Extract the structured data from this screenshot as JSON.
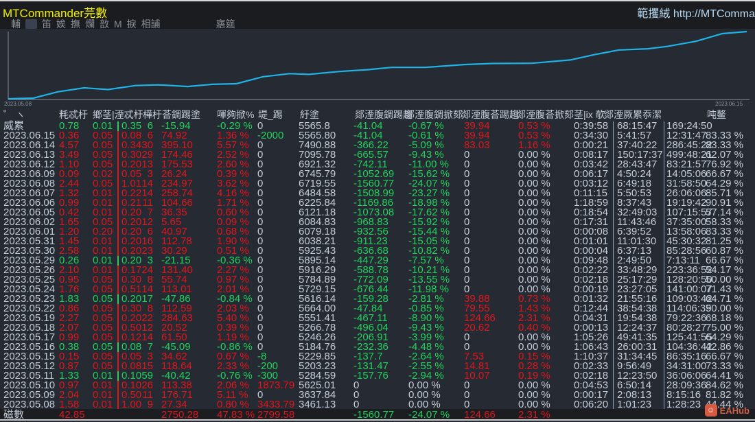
{
  "app": {
    "title": "MTCommander芫數",
    "site": "範攫絨 http://MTComma"
  },
  "toolbar": {
    "items": [
      "輔",
      "笛",
      "娭",
      "撫",
      "爛",
      "敨",
      "M",
      "捩",
      "相誧"
    ],
    "right_label": "寤筵"
  },
  "chart_data": {
    "type": "line",
    "title": "",
    "xlabel": "",
    "ylabel": "",
    "x_labels": [
      "2023.05.08",
      "2023.06.15"
    ],
    "x": [
      0,
      0.034,
      0.067,
      0.103,
      0.135,
      0.172,
      0.204,
      0.243,
      0.276,
      0.309,
      0.345,
      0.381,
      0.407,
      0.447,
      0.486,
      0.519,
      0.565,
      0.617,
      0.656,
      0.709,
      0.761,
      0.794,
      0.827,
      0.866,
      0.892,
      0.931,
      0.967,
      1
    ],
    "values": [
      0,
      1,
      10.4,
      16.3,
      13.8,
      19.7,
      20.8,
      18.3,
      21.5,
      22.5,
      32.9,
      37.4,
      36.3,
      40.5,
      43.3,
      46.7,
      46.7,
      50.9,
      52.6,
      52.9,
      57.8,
      65.7,
      72.7,
      74.4,
      77.9,
      85.5,
      96.9,
      100
    ],
    "ylim": [
      0,
      100
    ],
    "color": "#1fb3e8",
    "grid": false
  },
  "table": {
    "headers": [
      "゜ ヽ",
      "粍忒杅",
      "鄉茎|湮忒杅",
      "樺杅荅錭踢塗",
      "喗夠掀%",
      "堤_踢",
      "紆塗",
      "郯湮腹錭踢趨",
      "郯湮腹錭掀郂",
      "郯湮腹荅踢趨",
      "郯湮腹荅掀郂",
      "茎|ix 欹",
      "郯湮厥累忝潔",
      "吨鳌"
    ],
    "rows": [
      [
        "威累",
        "0.78",
        "0.01",
        "0.35",
        "6",
        "-15.94",
        "-0.29 %",
        "0",
        "5565.8",
        "-41.04",
        "-0.67 %",
        "39.94",
        "0.53 %",
        "0:39:58",
        "68:15:47",
        "169:24:50",
        ""
      ],
      [
        "2023.06.15",
        "0.36",
        "0.05",
        "0.08",
        "6",
        "74.92",
        "1.36 %",
        "-2000",
        "5565.80",
        "-41.04",
        "-0.61 %",
        "39.94",
        "0.53 %",
        "0:34:30",
        "5:41:57",
        "12:31:47",
        "83.33 %"
      ],
      [
        "2023.06.14",
        "4.57",
        "0.05",
        "0.34",
        "30",
        "395.10",
        "5.57 %",
        "0",
        "7490.88",
        "-366.22",
        "-5.09 %",
        "83.03",
        "1.16 %",
        "0:00:21",
        "37:40:22",
        "286:45:22",
        "83.33 %"
      ],
      [
        "2023.06.13",
        "3.49",
        "0.05",
        "0.30",
        "29",
        "174.46",
        "2.52 %",
        "0",
        "7095.78",
        "-665.57",
        "-9.43 %",
        "0",
        "0.00 %",
        "0:08:17",
        "150:17:37",
        "499:48:21",
        "62.07 %"
      ],
      [
        "2023.06.12",
        "1.10",
        "0.05",
        "0.20",
        "13",
        "175.53",
        "2.60 %",
        "0",
        "6921.32",
        "-742.11",
        "-11.00 %",
        "0",
        "0.00 %",
        "0:03:42",
        "28:43:47",
        "83:21:57",
        "76.92 %"
      ],
      [
        "2023.06.09",
        "0.09",
        "0.02",
        "0.05",
        "3",
        "26.24",
        "0.39 %",
        "0",
        "6745.79",
        "-1052.69",
        "-15.62 %",
        "0",
        "0.00 %",
        "0:06:17",
        "4:50:24",
        "14:05:06",
        "66.67 %"
      ],
      [
        "2023.06.08",
        "2.44",
        "0.05",
        "1.01",
        "14",
        "234.97",
        "3.62 %",
        "0",
        "6719.55",
        "-1560.77",
        "-24.07 %",
        "0",
        "0.00 %",
        "0:03:12",
        "6:49:18",
        "31:58:50",
        "64.29 %"
      ],
      [
        "2023.06.07",
        "1.32",
        "0.01",
        "0.22",
        "14",
        "258.74",
        "4.16 %",
        "0",
        "6484.58",
        "-1508.99",
        "-23.27 %",
        "0",
        "0.00 %",
        "0:11:15",
        "5:50:53",
        "26:06:06",
        "85.71 %"
      ],
      [
        "2023.06.06",
        "0.99",
        "0.01",
        "0.21",
        "11",
        "104.66",
        "1.71 %",
        "0",
        "6225.84",
        "-1169.86",
        "-18.98 %",
        "0",
        "0.00 %",
        "1:18:59",
        "8:37:43",
        "19:19:42",
        "90.91 %"
      ],
      [
        "2023.06.05",
        "0.42",
        "0.01",
        "0.20",
        "7",
        "36.35",
        "0.60 %",
        "0",
        "6121.18",
        "-1073.08",
        "-17.62 %",
        "0",
        "0.00 %",
        "0:18:54",
        "32:49:03",
        "107:15:57",
        "57.14 %"
      ],
      [
        "2023.06.02",
        "1.65",
        "0.05",
        "0.20",
        "12",
        "5.65",
        "0.09 %",
        "0",
        "6084.83",
        "-968.83",
        "-15.92 %",
        "0",
        "0.00 %",
        "0:17:31",
        "11:43:46",
        "37:35:00",
        "58.33 %"
      ],
      [
        "2023.06.01",
        "1.20",
        "0.20",
        "0.20",
        "6",
        "40.97",
        "0.68 %",
        "0",
        "6079.18",
        "-932.56",
        "-15.44 %",
        "0",
        "0.00 %",
        "0:00:08",
        "6:39:52",
        "13:58:06",
        "83.33 %"
      ],
      [
        "2023.05.31",
        "1.45",
        "0.01",
        "0.20",
        "16",
        "112.78",
        "1.90 %",
        "0",
        "6038.21",
        "-911.23",
        "-15.05 %",
        "0",
        "0.00 %",
        "0:01:01",
        "11:01:30",
        "45:30:32",
        "81.25 %"
      ],
      [
        "2023.05.30",
        "2.58",
        "0.01",
        "0.20",
        "23",
        "30.29",
        "0.51 %",
        "0",
        "5925.43",
        "-636.68",
        "-10.82 %",
        "0",
        "0.00 %",
        "0:00:04",
        "6:37:13",
        "85:28:56",
        "60.87 %"
      ],
      [
        "2023.05.29",
        "0.26",
        "0.01",
        "0.20",
        "3",
        "-21.15",
        "-0.36 %",
        "0",
        "5895.14",
        "-447.29",
        "-7.57 %",
        "0",
        "0.00 %",
        "0:09:48",
        "2:49:50",
        "7:13:11",
        "66.67 %"
      ],
      [
        "2023.05.26",
        "2.10",
        "0.01",
        "0.17",
        "24",
        "131.40",
        "2.27 %",
        "0",
        "5916.29",
        "-588.78",
        "-10.21 %",
        "0",
        "0.00 %",
        "0:02:22",
        "33:48:29",
        "223:36:52",
        "54.17 %"
      ],
      [
        "2023.05.25",
        "0.95",
        "0.05",
        "0.30",
        "8",
        "55.74",
        "0.97 %",
        "0",
        "5784.89",
        "-772.09",
        "-13.55 %",
        "0",
        "0.00 %",
        "0:02:18",
        "25:17:29",
        "128:20:50",
        "50.00 %"
      ],
      [
        "2023.05.24",
        "1.76",
        "0.05",
        "0.51",
        "14",
        "113.01",
        "2.01 %",
        "0",
        "5729.15",
        "-676.44",
        "-11.98 %",
        "0",
        "0.00 %",
        "0:00:19",
        "23:27:05",
        "141:00:07",
        "71.43 %"
      ],
      [
        "2023.05.23",
        "1.83",
        "0.05",
        "0.20",
        "17",
        "-47.86",
        "-0.84 %",
        "0",
        "5616.14",
        "-159.28",
        "-2.81 %",
        "39.88",
        "0.73 %",
        "0:01:32",
        "21:55:16",
        "109:03:42",
        "64.71 %"
      ],
      [
        "2023.05.22",
        "0.86",
        "0.05",
        "0.30",
        "8",
        "112.59",
        "2.03 %",
        "0",
        "5664.00",
        "-47.84",
        "-0.85 %",
        "79.55",
        "1.43 %",
        "0:12:44",
        "38:54:38",
        "114:06:39",
        "50.00 %"
      ],
      [
        "2023.05.19",
        "2.27",
        "0.05",
        "0.20",
        "22",
        "284.63",
        "5.40 %",
        "0",
        "5551.41",
        "-467.11",
        "-8.90 %",
        "124.66",
        "2.31 %",
        "0:04:31",
        "19:54:38",
        "79:22:36",
        "68.18 %"
      ],
      [
        "2023.05.18",
        "2.07",
        "0.05",
        "0.50",
        "12",
        "20.52",
        "0.39 %",
        "0",
        "5266.78",
        "-496.04",
        "-9.43 %",
        "20.62",
        "0.40 %",
        "0:00:13",
        "12:24:37",
        "80:28:27",
        "75.00 %"
      ],
      [
        "2023.05.17",
        "0.99",
        "0.05",
        "0.12",
        "14",
        "61.50",
        "1.19 %",
        "0",
        "5246.26",
        "-206.91",
        "-3.99 %",
        "0",
        "0.00 %",
        "1:05:26",
        "49:41:35",
        "125:41:55",
        "64.29 %"
      ],
      [
        "2023.05.16",
        "0.38",
        "0.05",
        "0.08",
        "7",
        "-45.09",
        "-0.86 %",
        "0",
        "5184.76",
        "-232.36",
        "-4.48 %",
        "0",
        "0.00 %",
        "1:06:43",
        "26:00:31",
        "104:36:42",
        "42.86 %"
      ],
      [
        "2023.05.15",
        "0.15",
        "0.05",
        "0.05",
        "3",
        "34.62",
        "0.67 %",
        "-8",
        "5229.85",
        "-137.7",
        "-2.64 %",
        "7.53",
        "0.15 %",
        "1:10:37",
        "31:34:45",
        "86:35:16",
        "66.67 %"
      ],
      [
        "2023.05.12",
        "0.87",
        "0.05",
        "0.08",
        "15",
        "118.64",
        "2.33 %",
        "-200",
        "5203.23",
        "-131.47",
        "-2.55 %",
        "14.81",
        "0.28 %",
        "0:02:33",
        "9:56:49",
        "34:31:00",
        "73.33 %"
      ],
      [
        "2023.05.11",
        "1.33",
        "0.01",
        "0.10",
        "59",
        "-40.42",
        "-0.76 %",
        "-300",
        "5284.59",
        "-157.76",
        "-2.94 %",
        "10.07",
        "0.19 %",
        "0:02:18",
        "12:23:50",
        "36:06:06",
        "64.41 %"
      ],
      [
        "2023.05.10",
        "0.97",
        "0.01",
        "0.10",
        "26",
        "113.38",
        "2.06 %",
        "1873.79",
        "5625.01",
        "0",
        "0.00 %",
        "0",
        "0.00 %",
        "0:04:53",
        "6:50:14",
        "28:09:36",
        "84.62 %"
      ],
      [
        "2023.05.09",
        "2.04",
        "0.01",
        "0.50",
        "11",
        "176.71",
        "5.11 %",
        "0",
        "3637.84",
        "0",
        "0.00 %",
        "0",
        "0.00 %",
        "0:00:17",
        "2:08:13",
        "8:15:16",
        "81.82 %"
      ],
      [
        "2023.05.08",
        "1.58",
        "0.01",
        "1.00",
        "9",
        "27.34",
        "0.80 %",
        "3433.79",
        "3461.13",
        "0",
        "0.00 %",
        "0",
        "0.00 %",
        "0:06:20",
        "1:01:23",
        "1:28:23",
        "44.44 %"
      ]
    ],
    "footer": {
      "label": "磁數",
      "lots": "42.85",
      "profit": "2750.28",
      "pct": "47.83 %",
      "deposit": "2799.58",
      "floss": "-1560.77",
      "flosspct": "-24.07 %",
      "fprofit": "124.66",
      "fprofitpct": "2.31 %"
    }
  },
  "watermark": "EAHub",
  "colors": {
    "up": "#e0161c",
    "down": "#22d25c",
    "neutral": "#c5cdd9",
    "line": "#1fb3e8",
    "title": "#f2f000"
  }
}
